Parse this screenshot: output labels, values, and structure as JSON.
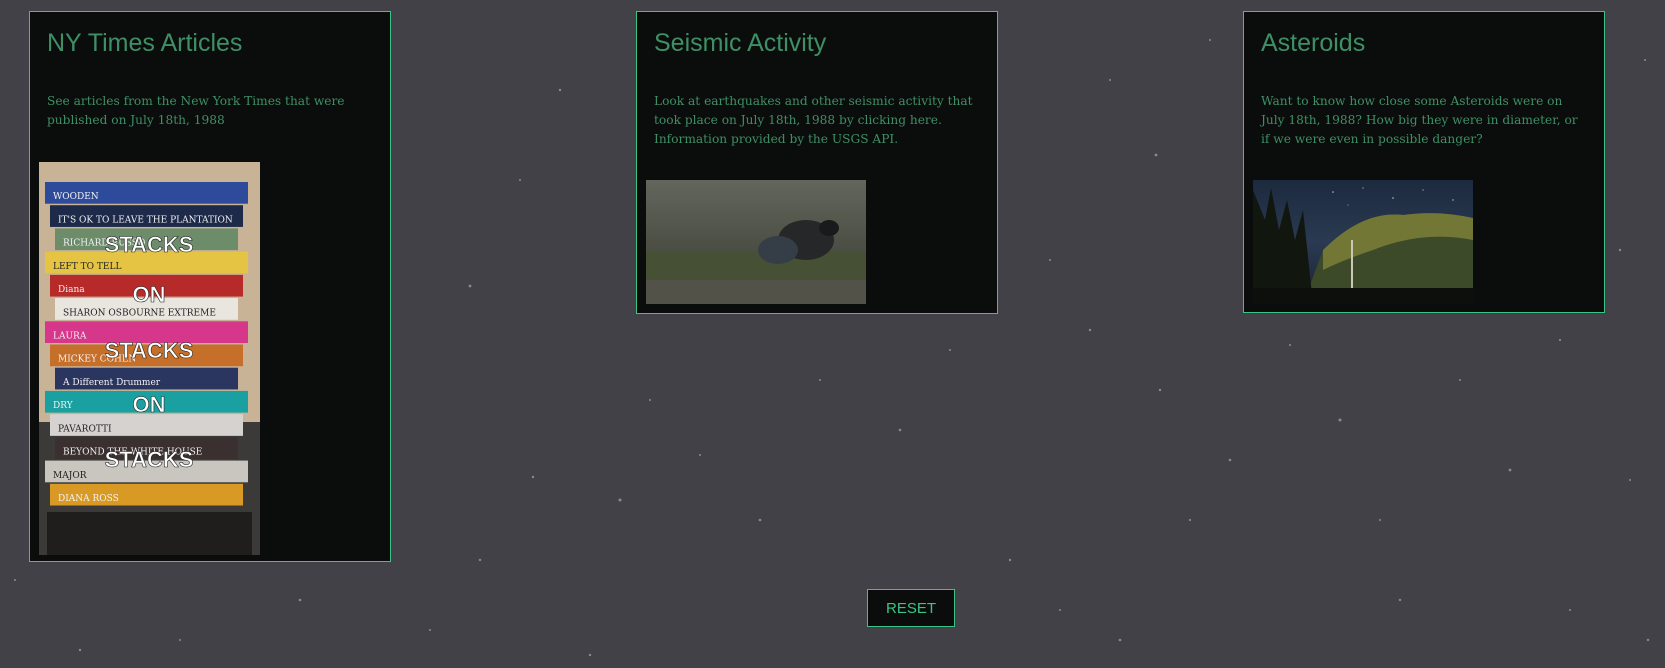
{
  "cards": [
    {
      "title": "NY Times Articles",
      "description": "See articles from the New York Times that were published on July 18th, 1988",
      "image_overlay": [
        "STACKS",
        "ON",
        "STACKS",
        "ON",
        "STACKS"
      ],
      "book_spines": [
        "WOODEN",
        "IT'S OK TO LEAVE THE PLANTATION",
        "RICHARD RUSSO",
        "LEFT TO TELL",
        "Diana",
        "SHARON OSBOURNE EXTREME",
        "LAURA",
        "MICKEY COHEN",
        "A Different Drummer",
        "DRY",
        "PAVAROTTI",
        "BEYOND THE WHITE HOUSE",
        "MAJOR",
        "DIANA ROSS"
      ]
    },
    {
      "title": "Seismic Activity",
      "description": "Look at earthquakes and other seismic activity that took place on July 18th, 1988 by clicking here. Information provided by the USGS API."
    },
    {
      "title": "Asteroids",
      "description": "Want to know how close some Asteroids were on July 18th, 1988? How big they were in diameter, or if we were even in possible danger?"
    }
  ],
  "reset_label": "RESET",
  "colors": {
    "background": "#424147",
    "card_background": "#0b0d0c",
    "accent_border": "#3cc487",
    "text_green": "#3f8f66"
  }
}
